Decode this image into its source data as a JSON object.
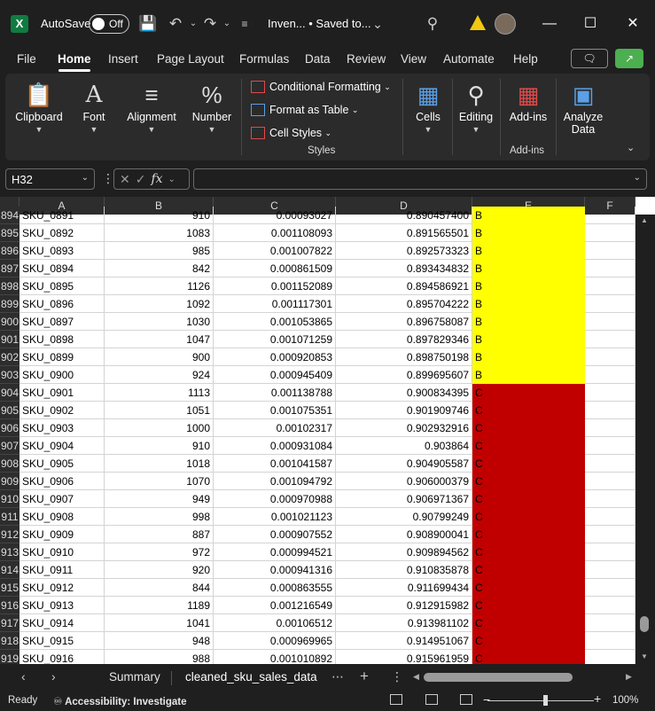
{
  "titlebar": {
    "app_icon": "excel-logo-icon",
    "app_letter": "X",
    "autosave_label": "AutoSave",
    "autosave_state": "Off",
    "doc_title": "Inven... • Saved to...",
    "doc_chevron": "⌄"
  },
  "tabs": [
    {
      "label": "File"
    },
    {
      "label": "Home",
      "active": true
    },
    {
      "label": "Insert"
    },
    {
      "label": "Page Layout"
    },
    {
      "label": "Formulas"
    },
    {
      "label": "Data"
    },
    {
      "label": "Review"
    },
    {
      "label": "View"
    },
    {
      "label": "Automate"
    },
    {
      "label": "Help"
    }
  ],
  "ribbon": {
    "clipboard": "Clipboard",
    "font": "Font",
    "alignment": "Alignment",
    "number": "Number",
    "conditional_formatting": "Conditional Formatting",
    "format_as_table": "Format as Table",
    "cell_styles": "Cell Styles",
    "styles_group": "Styles",
    "cells": "Cells",
    "editing": "Editing",
    "addins": "Add-ins",
    "addins_group": "Add-ins",
    "analyze_data_1": "Analyze",
    "analyze_data_2": "Data"
  },
  "formula_bar": {
    "name_box": "H32",
    "value": ""
  },
  "columns": [
    "A",
    "B",
    "C",
    "D",
    "E",
    "F"
  ],
  "rows": [
    {
      "n": "894",
      "a": "SKU_0891",
      "b": "910",
      "c": "0.00093027",
      "d": "0.890457400",
      "e": "B",
      "cls": "B"
    },
    {
      "n": "895",
      "a": "SKU_0892",
      "b": "1083",
      "c": "0.001108093",
      "d": "0.891565501",
      "e": "B",
      "cls": "B"
    },
    {
      "n": "896",
      "a": "SKU_0893",
      "b": "985",
      "c": "0.001007822",
      "d": "0.892573323",
      "e": "B",
      "cls": "B"
    },
    {
      "n": "897",
      "a": "SKU_0894",
      "b": "842",
      "c": "0.000861509",
      "d": "0.893434832",
      "e": "B",
      "cls": "B"
    },
    {
      "n": "898",
      "a": "SKU_0895",
      "b": "1126",
      "c": "0.001152089",
      "d": "0.894586921",
      "e": "B",
      "cls": "B"
    },
    {
      "n": "899",
      "a": "SKU_0896",
      "b": "1092",
      "c": "0.001117301",
      "d": "0.895704222",
      "e": "B",
      "cls": "B"
    },
    {
      "n": "900",
      "a": "SKU_0897",
      "b": "1030",
      "c": "0.001053865",
      "d": "0.896758087",
      "e": "B",
      "cls": "B"
    },
    {
      "n": "901",
      "a": "SKU_0898",
      "b": "1047",
      "c": "0.001071259",
      "d": "0.897829346",
      "e": "B",
      "cls": "B"
    },
    {
      "n": "902",
      "a": "SKU_0899",
      "b": "900",
      "c": "0.000920853",
      "d": "0.898750198",
      "e": "B",
      "cls": "B"
    },
    {
      "n": "903",
      "a": "SKU_0900",
      "b": "924",
      "c": "0.000945409",
      "d": "0.899695607",
      "e": "B",
      "cls": "B"
    },
    {
      "n": "904",
      "a": "SKU_0901",
      "b": "1113",
      "c": "0.001138788",
      "d": "0.900834395",
      "e": "C",
      "cls": "C"
    },
    {
      "n": "905",
      "a": "SKU_0902",
      "b": "1051",
      "c": "0.001075351",
      "d": "0.901909746",
      "e": "C",
      "cls": "C"
    },
    {
      "n": "906",
      "a": "SKU_0903",
      "b": "1000",
      "c": "0.00102317",
      "d": "0.902932916",
      "e": "C",
      "cls": "C"
    },
    {
      "n": "907",
      "a": "SKU_0904",
      "b": "910",
      "c": "0.000931084",
      "d": "0.903864",
      "e": "C",
      "cls": "C"
    },
    {
      "n": "908",
      "a": "SKU_0905",
      "b": "1018",
      "c": "0.001041587",
      "d": "0.904905587",
      "e": "C",
      "cls": "C"
    },
    {
      "n": "909",
      "a": "SKU_0906",
      "b": "1070",
      "c": "0.001094792",
      "d": "0.906000379",
      "e": "C",
      "cls": "C"
    },
    {
      "n": "910",
      "a": "SKU_0907",
      "b": "949",
      "c": "0.000970988",
      "d": "0.906971367",
      "e": "C",
      "cls": "C"
    },
    {
      "n": "911",
      "a": "SKU_0908",
      "b": "998",
      "c": "0.001021123",
      "d": "0.90799249",
      "e": "C",
      "cls": "C"
    },
    {
      "n": "912",
      "a": "SKU_0909",
      "b": "887",
      "c": "0.000907552",
      "d": "0.908900041",
      "e": "C",
      "cls": "C"
    },
    {
      "n": "913",
      "a": "SKU_0910",
      "b": "972",
      "c": "0.000994521",
      "d": "0.909894562",
      "e": "C",
      "cls": "C"
    },
    {
      "n": "914",
      "a": "SKU_0911",
      "b": "920",
      "c": "0.000941316",
      "d": "0.910835878",
      "e": "C",
      "cls": "C"
    },
    {
      "n": "915",
      "a": "SKU_0912",
      "b": "844",
      "c": "0.000863555",
      "d": "0.911699434",
      "e": "C",
      "cls": "C"
    },
    {
      "n": "916",
      "a": "SKU_0913",
      "b": "1189",
      "c": "0.001216549",
      "d": "0.912915982",
      "e": "C",
      "cls": "C"
    },
    {
      "n": "917",
      "a": "SKU_0914",
      "b": "1041",
      "c": "0.00106512",
      "d": "0.913981102",
      "e": "C",
      "cls": "C"
    },
    {
      "n": "918",
      "a": "SKU_0915",
      "b": "948",
      "c": "0.000969965",
      "d": "0.914951067",
      "e": "C",
      "cls": "C"
    },
    {
      "n": "919",
      "a": "SKU_0916",
      "b": "988",
      "c": "0.001010892",
      "d": "0.915961959",
      "e": "C",
      "cls": "C"
    }
  ],
  "class_colors": {
    "B": "#ffff00",
    "C": "#c00000"
  },
  "sheets": [
    {
      "label": "Summary"
    },
    {
      "label": "cleaned_sku_sales_data",
      "active": true
    }
  ],
  "status": {
    "ready": "Ready",
    "accessibility": "Accessibility: Investigate",
    "zoom": "100%"
  }
}
